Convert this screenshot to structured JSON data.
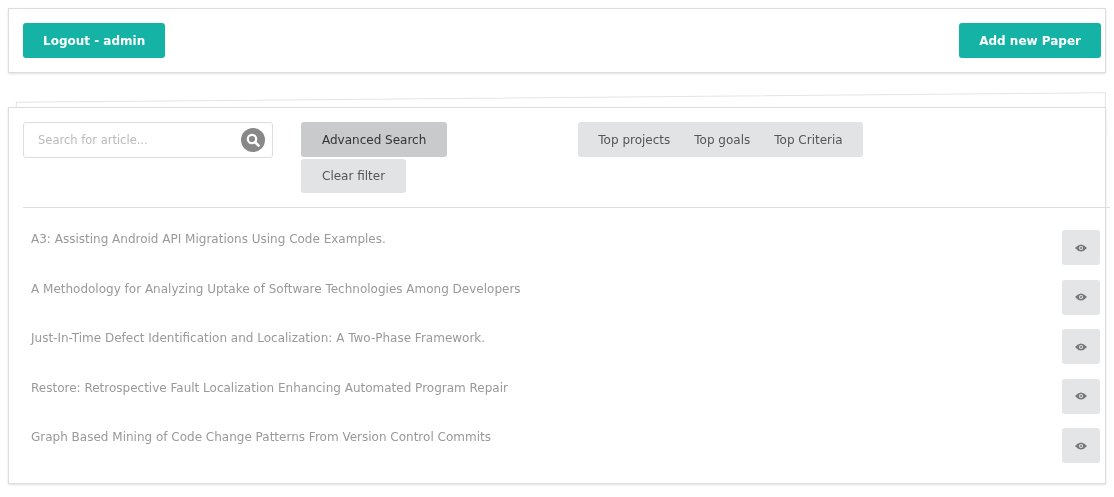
{
  "header": {
    "logout_button": "Logout - admin",
    "add_button": "Add new Paper"
  },
  "search": {
    "placeholder": "Search for article..."
  },
  "filter_buttons": [
    {
      "label": "Advanced Search",
      "pressed": true
    },
    {
      "label": "Clear filter",
      "pressed": false
    }
  ],
  "top_tabs": [
    "Top projects",
    "Top goals",
    "Top Criteria"
  ],
  "papers": [
    {
      "title": "A3: Assisting Android API Migrations Using Code Examples."
    },
    {
      "title": "A Methodology for Analyzing Uptake of Software Technologies Among Developers"
    },
    {
      "title": "Just-In-Time Defect Identification and Localization: A Two-Phase Framework."
    },
    {
      "title": "Restore: Retrospective Fault Localization Enhancing Automated Program Repair"
    },
    {
      "title": "Graph Based Mining of Code Change Patterns From Version Control Commits"
    }
  ]
}
